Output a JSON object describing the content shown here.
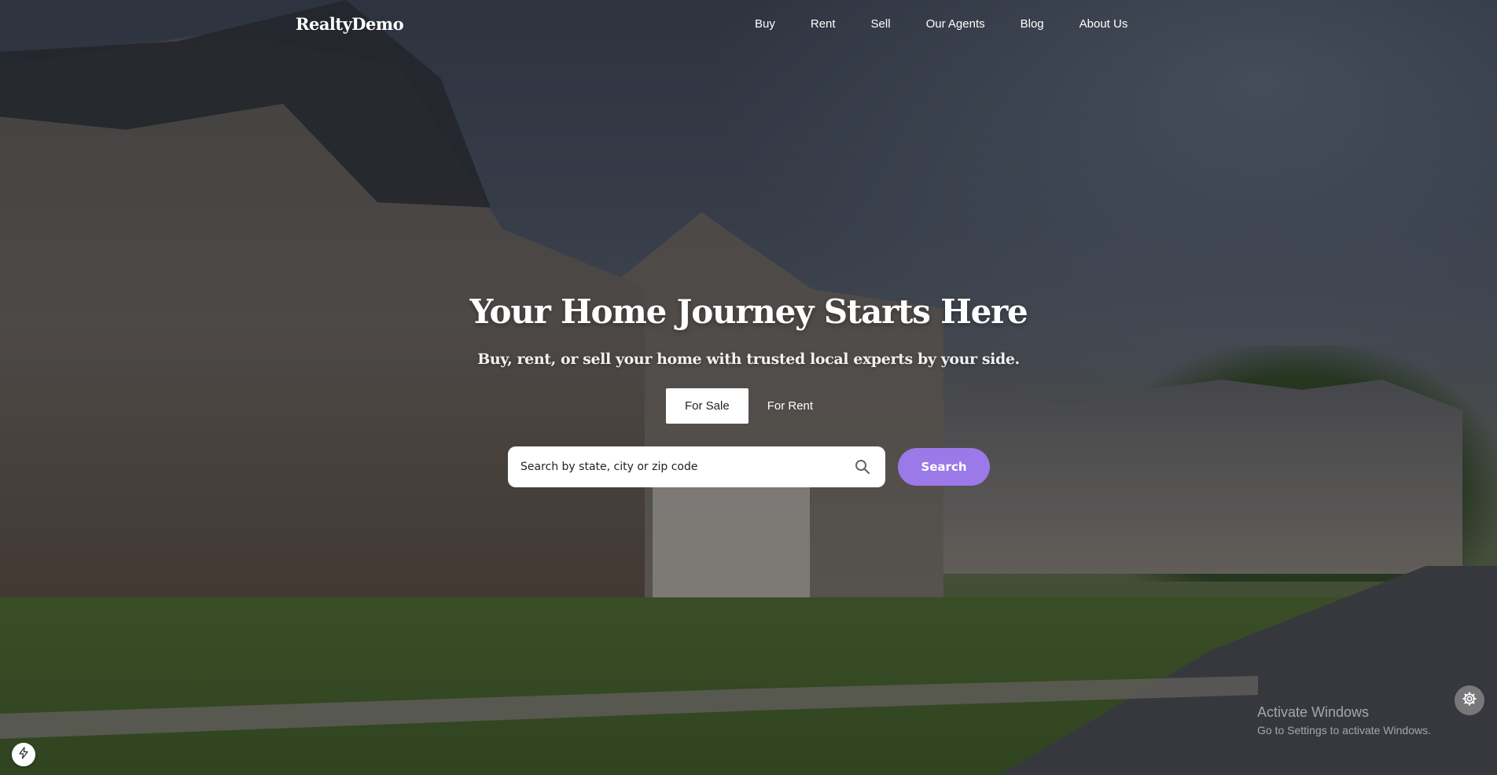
{
  "header": {
    "logo": "RealtyDemo",
    "nav": [
      "Buy",
      "Rent",
      "Sell",
      "Our Agents",
      "Blog",
      "About Us"
    ]
  },
  "hero": {
    "title": "Your Home Journey Starts Here",
    "subtitle": "Buy, rent, or sell your home with trusted local experts by your side."
  },
  "tabs": {
    "items": [
      "For Sale",
      "For Rent"
    ],
    "active": "For Sale"
  },
  "search": {
    "placeholder": "Search by state, city or zip code",
    "button_label": "Search",
    "button_color": "#9b79e8"
  },
  "watermark": {
    "title": "Activate Windows",
    "subtitle": "Go to Settings to activate Windows."
  },
  "icons": {
    "search": "search-icon",
    "settings": "gear-icon",
    "bolt": "bolt-icon"
  }
}
